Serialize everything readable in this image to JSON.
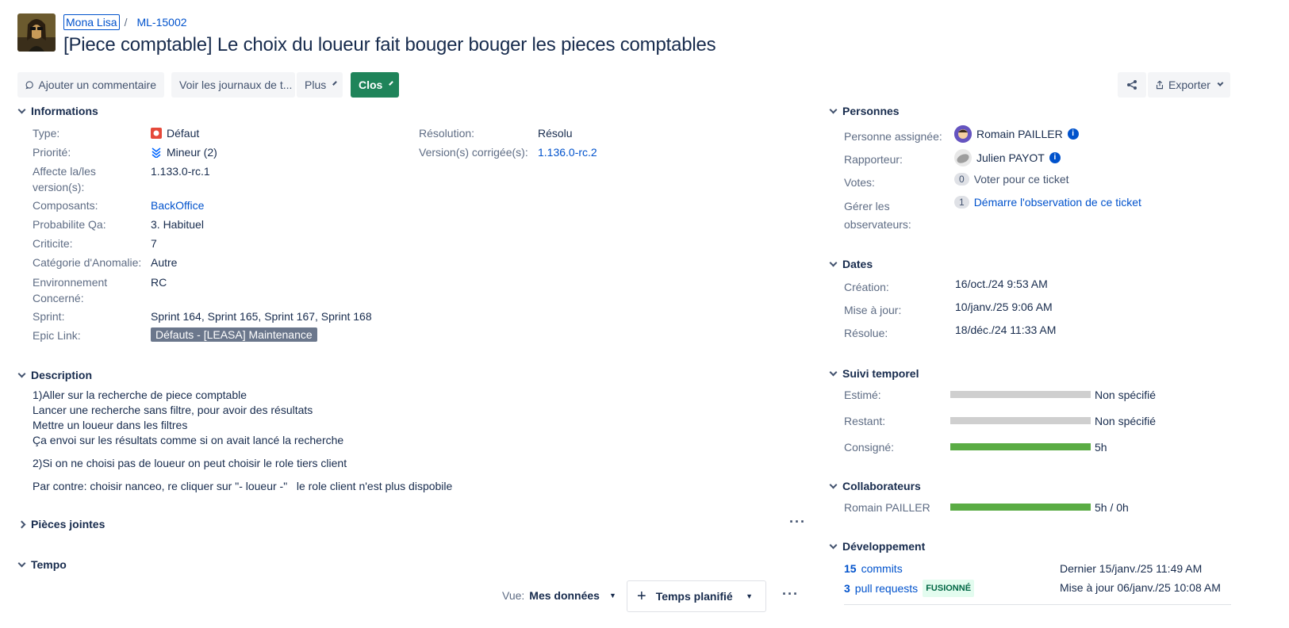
{
  "header": {
    "project_name": "Mona Lisa",
    "separator": "/",
    "issue_key": "ML-15002",
    "title": "[Piece comptable] Le choix du loueur fait bouger bouger les pieces comptables"
  },
  "toolbar": {
    "comment_label": "Ajouter un commentaire",
    "logs_label": "Voir les journaux de t...",
    "more_label": "Plus",
    "status_label": "Clos",
    "export_label": "Exporter"
  },
  "details": {
    "heading": "Informations",
    "type_label": "Type:",
    "type_value": "Défaut",
    "priority_label": "Priorité:",
    "priority_value": "Mineur (2)",
    "affects_label_1": "Affecte la/les",
    "affects_label_2": "version(s):",
    "affects_value": "1.133.0-rc.1",
    "components_label": "Composants:",
    "components_value": "BackOffice",
    "qa_label": "Probabilite Qa:",
    "qa_value": "3. Habituel",
    "criticity_label": "Criticite:",
    "criticity_value": "7",
    "category_label": "Catégorie d'Anomalie:",
    "category_value": "Autre",
    "env_label_1": "Environnement",
    "env_label_2": "Concerné:",
    "env_value": "RC",
    "sprint_label": "Sprint:",
    "sprint_value": "Sprint 164, Sprint 165, Sprint 167, Sprint 168",
    "epic_label": "Epic Link:",
    "epic_value": "Défauts - [LEASA] Maintenance",
    "resolution_label": "Résolution:",
    "resolution_value": "Résolu",
    "fixversion_label": "Version(s) corrigée(s):",
    "fixversion_value": "1.136.0-rc.2"
  },
  "description": {
    "heading": "Description",
    "lines": [
      "1)Aller sur la recherche de piece comptable",
      "Lancer une recherche sans filtre, pour avoir des résultats",
      "Mettre un loueur dans les filtres",
      "Ça envoi sur les résultats comme si on avait lancé la recherche"
    ],
    "para2": "2)Si on ne choisi pas de loueur on peut choisir le role tiers client",
    "para3": "Par contre: choisir nanceo, re cliquer sur \"- loueur -\"   le role client n'est plus dispobile"
  },
  "attachments": {
    "heading": "Pièces jointes"
  },
  "tempo": {
    "heading": "Tempo",
    "view_label": "Vue:",
    "view_value": "Mes données",
    "planned_label": "Temps planifié"
  },
  "people": {
    "heading": "Personnes",
    "assignee_label": "Personne assignée:",
    "assignee_value": "Romain PAILLER",
    "reporter_label": "Rapporteur:",
    "reporter_value": "Julien PAYOT",
    "votes_label": "Votes:",
    "votes_count": "0",
    "votes_action": "Voter pour ce ticket",
    "watchers_label_1": "Gérer les",
    "watchers_label_2": "observateurs:",
    "watchers_count": "1",
    "watchers_action": "Démarre l'observation de ce ticket"
  },
  "dates": {
    "heading": "Dates",
    "created_label": "Création:",
    "created_value": "16/oct./24 9:53 AM",
    "updated_label": "Mise à jour:",
    "updated_value": "10/janv./25 9:06 AM",
    "resolved_label": "Résolue:",
    "resolved_value": "18/déc./24 11:33 AM"
  },
  "time_tracking": {
    "heading": "Suivi temporel",
    "estimated_label": "Estimé:",
    "estimated_value": "Non spécifié",
    "estimated_fraction": 0,
    "remaining_label": "Restant:",
    "remaining_value": "Non spécifié",
    "remaining_fraction": 0,
    "logged_label": "Consigné:",
    "logged_value": "5h",
    "logged_fraction": 1
  },
  "collaborators": {
    "heading": "Collaborateurs",
    "name": "Romain PAILLER",
    "value": "5h / 0h",
    "fraction": 1
  },
  "development": {
    "heading": "Développement",
    "commits_count": "15",
    "commits_label": "commits",
    "commits_date": "Dernier 15/janv./25 11:49 AM",
    "prs_count": "3",
    "prs_label": "pull requests",
    "prs_status": "FUSIONNÉ",
    "prs_date": "Mise à jour 06/janv./25 10:08 AM"
  },
  "colors": {
    "status": "#1f845a",
    "link": "#0052cc",
    "bar_fill": "#5aac44",
    "bar_empty": "#cfcfcf",
    "bug": "#e5493a"
  }
}
